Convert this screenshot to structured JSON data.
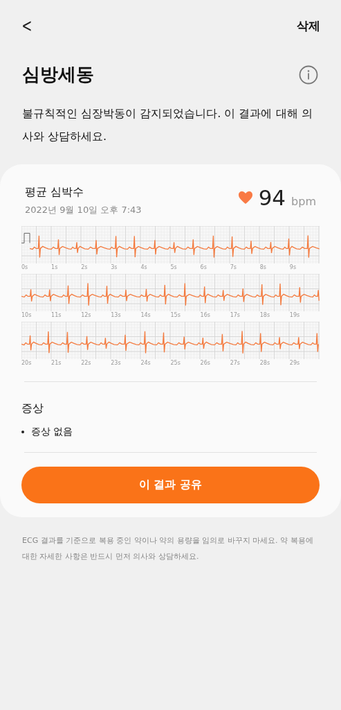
{
  "top_bar": {
    "back": "<",
    "action": "삭제"
  },
  "title": "심방세동",
  "description": "불규칙적인 심장박동이 감지되었습니다. 이 결과에 대해 의사와 상담하세요.",
  "card": {
    "label": "평균 심박수",
    "date": "2022년 9월 10일 오후 7:43",
    "value": "94",
    "unit": "bpm",
    "strips": [
      {
        "calibration_pulse": true,
        "ticks": [
          "0s",
          "1s",
          "2s",
          "3s",
          "4s",
          "5s",
          "6s",
          "7s",
          "8s",
          "9s"
        ]
      },
      {
        "calibration_pulse": false,
        "ticks": [
          "10s",
          "11s",
          "12s",
          "13s",
          "14s",
          "15s",
          "16s",
          "17s",
          "18s",
          "19s"
        ]
      },
      {
        "calibration_pulse": false,
        "ticks": [
          "20s",
          "21s",
          "22s",
          "23s",
          "24s",
          "25s",
          "26s",
          "27s",
          "28s",
          "29s"
        ]
      }
    ],
    "symptoms_title": "증상",
    "symptoms": [
      "증상 없음"
    ],
    "share_button": "이 결과 공유"
  },
  "footer": "ECG 결과를 기준으로 복용 중인 약이나 약의 용량을 임의로 바꾸지 마세요. 약 복용에 대한 자세한 사항은 반드시 먼저 의사와 상담하세요."
}
